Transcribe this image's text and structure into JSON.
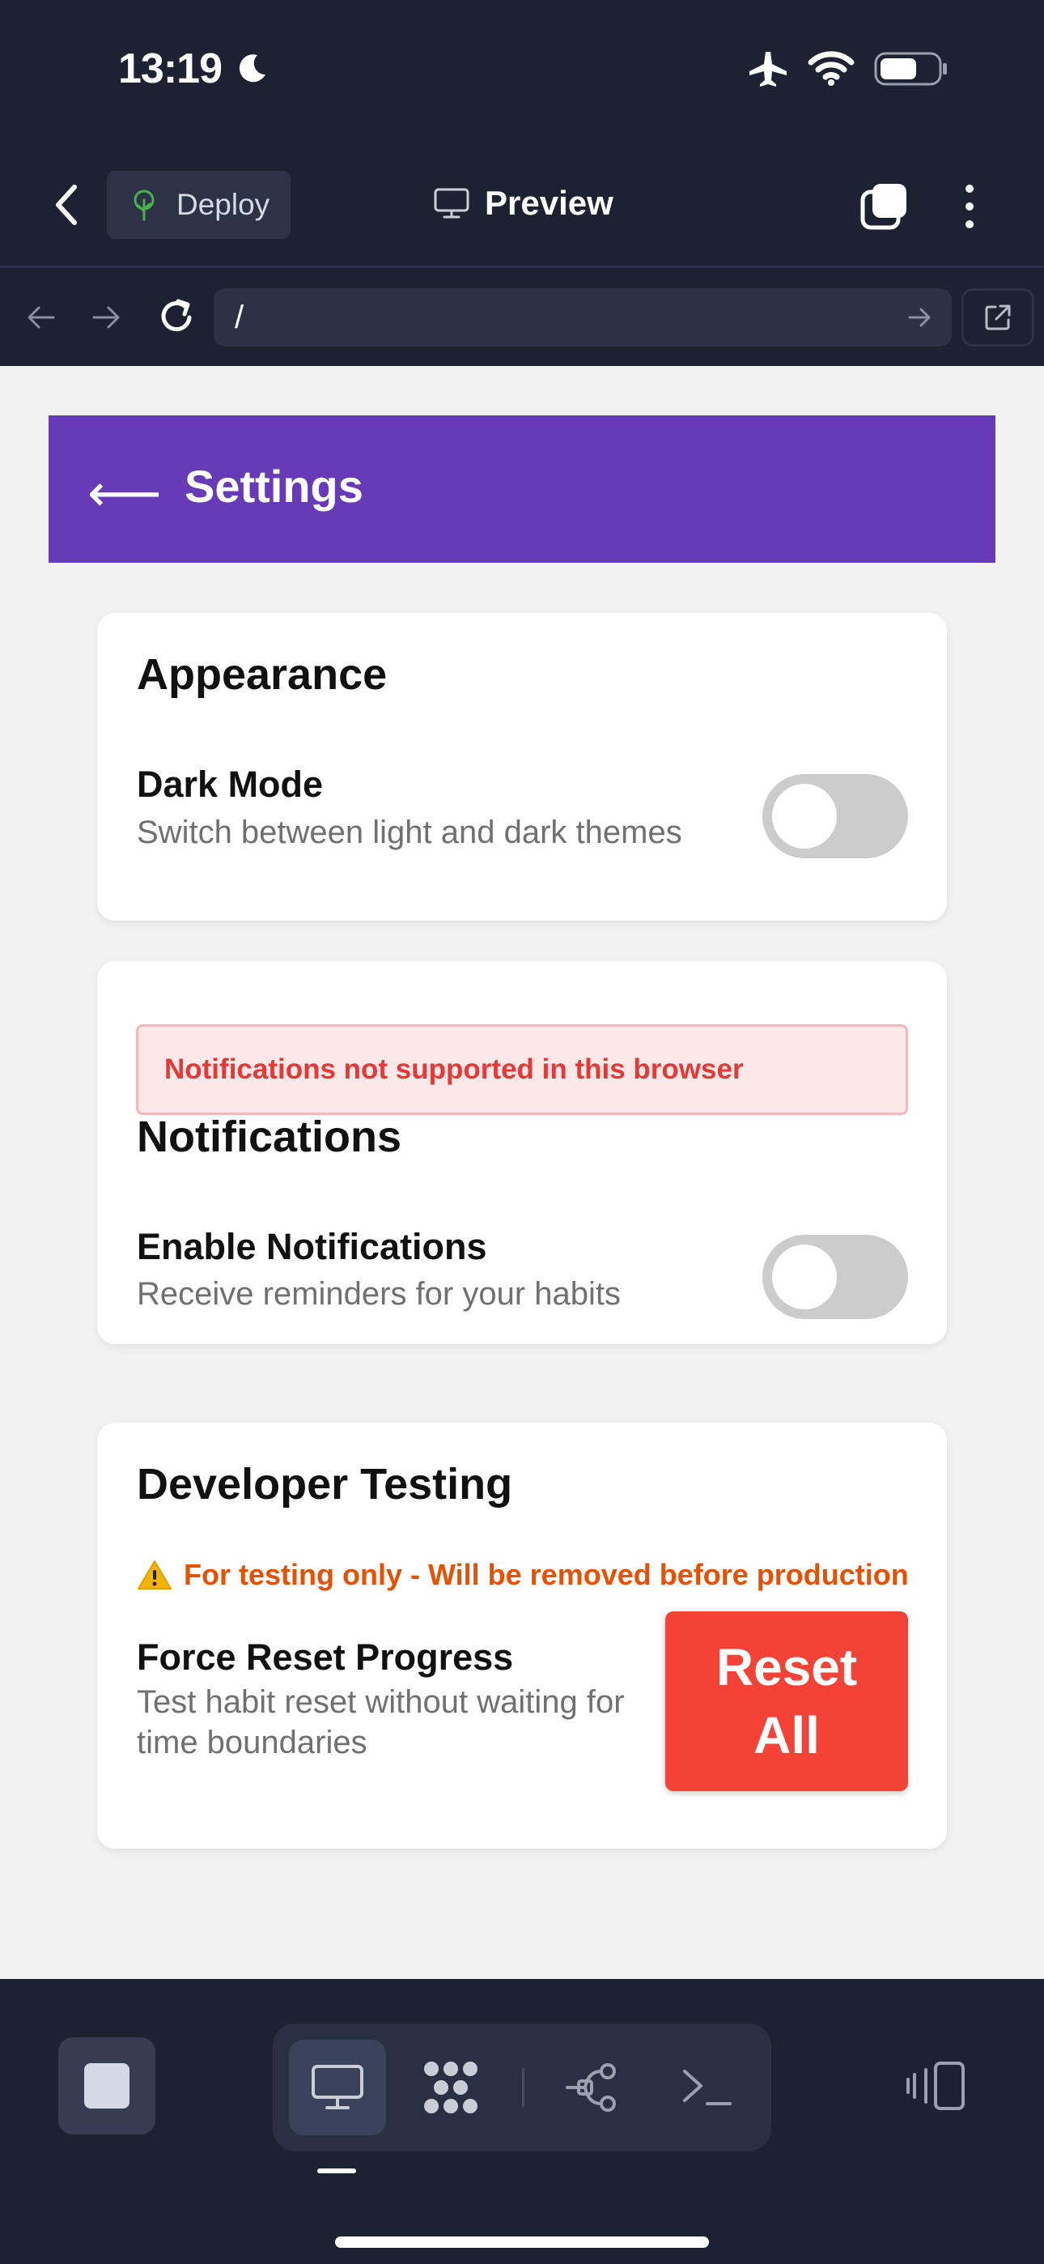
{
  "status_bar": {
    "time": "13:19",
    "icons": [
      "moon-icon",
      "airplane-icon",
      "wifi-icon",
      "battery-icon"
    ]
  },
  "app_header": {
    "deploy_label": "Deploy",
    "preview_label": "Preview",
    "icons": [
      "chevron-left-icon",
      "deploy-icon",
      "monitor-icon",
      "tabs-icon",
      "more-vertical-icon"
    ]
  },
  "browser": {
    "url": "/",
    "icons": [
      "arrow-left-icon",
      "arrow-right-icon",
      "reload-icon",
      "go-arrow-icon",
      "open-external-icon"
    ]
  },
  "page": {
    "back_arrow": "⟵",
    "title": "Settings",
    "accent_color": "#673ab7",
    "appearance": {
      "heading": "Appearance",
      "dark_mode_title": "Dark Mode",
      "dark_mode_desc": "Switch between light and dark themes",
      "dark_mode_on": false
    },
    "notifications": {
      "error": "Notifications not supported in this browser",
      "heading": "Notifications",
      "enable_title": "Enable Notifications",
      "enable_desc": "Receive reminders for your habits",
      "enabled": false
    },
    "developer": {
      "heading": "Developer Testing",
      "warning": "For testing only - Will be removed before production",
      "reset_title": "Force Reset Progress",
      "reset_desc": "Test habit reset without waiting for time boundaries",
      "reset_button": "Reset All",
      "reset_color": "#f44336",
      "warning_color": "#e65100"
    }
  },
  "toolbar": {
    "items": [
      "stop-icon",
      "monitor-icon",
      "apps-icon",
      "graph-icon",
      "terminal-icon",
      "device-switch-icon"
    ],
    "active": "monitor-icon"
  }
}
